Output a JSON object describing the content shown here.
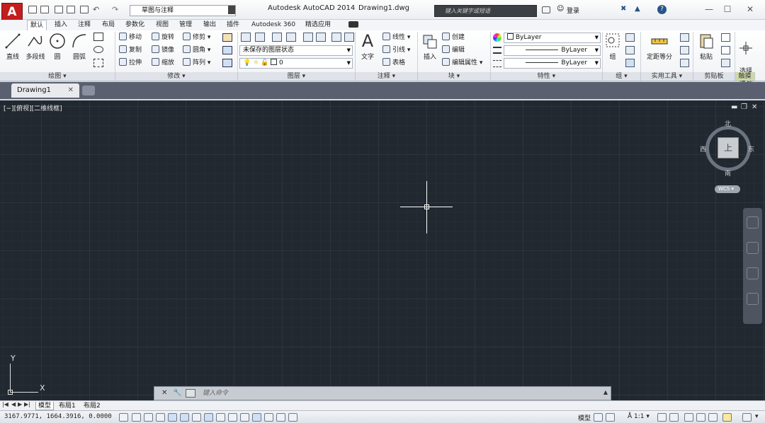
{
  "titlebar": {
    "workspace": "草图与注释",
    "app_title": "Autodesk AutoCAD 2014",
    "file_name": "Drawing1.dwg",
    "search_placeholder": "键入关键字或短语",
    "sign_in": "登录"
  },
  "ribbon": {
    "tabs": [
      "默认",
      "插入",
      "注释",
      "布局",
      "参数化",
      "视图",
      "管理",
      "输出",
      "插件",
      "Autodesk 360",
      "精选应用"
    ],
    "draw": {
      "line": "直线",
      "polyline": "多段线",
      "circle": "圆",
      "arc": "圆弧",
      "title": "绘图"
    },
    "modify": {
      "move": "移动",
      "rotate": "旋转",
      "trim": "修剪",
      "copy": "复制",
      "mirror": "镜像",
      "fillet": "圆角",
      "stretch": "拉伸",
      "scale": "缩放",
      "array": "阵列",
      "title": "修改"
    },
    "layers": {
      "state": "未保存的图层状态",
      "layer_name": "0",
      "title": "图层"
    },
    "annotation": {
      "text": "文字",
      "linear": "线性",
      "leader": "引线",
      "table": "表格",
      "title": "注释"
    },
    "block": {
      "insert": "插入",
      "create": "创建",
      "edit": "编辑",
      "edit_attr": "编辑属性",
      "title": "块"
    },
    "properties": {
      "color": "ByLayer",
      "linetype": "ByLayer",
      "lineweight": "ByLayer",
      "title": "特性"
    },
    "groups": {
      "group": "组",
      "title": "组"
    },
    "utilities": {
      "measure": "定距等分",
      "title": "实用工具"
    },
    "clipboard": {
      "paste": "粘贴",
      "title": "剪贴板"
    },
    "touch": {
      "select_mode": "选择\n模式",
      "title": "触摸"
    }
  },
  "document": {
    "tab": "Drawing1"
  },
  "viewport": {
    "label": "[−][俯视][二维线框]",
    "viewcube": {
      "north": "北",
      "south": "南",
      "east": "东",
      "west": "西",
      "face": "上"
    },
    "wcs": "WCS",
    "ucs_x": "X",
    "ucs_y": "Y"
  },
  "command": {
    "placeholder": "键入命令"
  },
  "layout_tabs": [
    "模型",
    "布局1",
    "布局2"
  ],
  "status": {
    "coords": "3167.9771, 1664.3916, 0.0000",
    "model": "模型",
    "scale": "1:1"
  },
  "colors": {
    "canvas": "#212830",
    "accent": "#c41d1d"
  }
}
